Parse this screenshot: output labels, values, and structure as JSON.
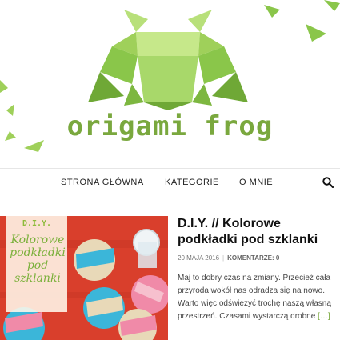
{
  "site": {
    "logo_text": "origami frog"
  },
  "nav": {
    "items": [
      "STRONA GŁÓWNA",
      "KATEGORIE",
      "O MNIE"
    ]
  },
  "post": {
    "title": "D.I.Y. // Kolorowe podkładki pod szklanki",
    "date": "20 MAJA 2016",
    "comments": "KOMENTARZE: 0",
    "excerpt": "Maj to dobry czas na zmiany. Przecież cała przyroda wokół nas odradza się na nowo. Warto więc odświeżyć trochę naszą własną przestrzeń. Czasami wystarczą drobne",
    "read_more": "[…]",
    "thumb_badge": "D.I.Y.",
    "thumb_title": "Kolorowe podkładki pod szklanki"
  },
  "colors": {
    "accent": "#7aa83e",
    "frog_light": "#b8e07a",
    "frog_mid": "#9fd05a",
    "frog_dark": "#6fa836",
    "thumb_background": "#d93f2c"
  },
  "icons": {
    "search": "search-icon"
  }
}
